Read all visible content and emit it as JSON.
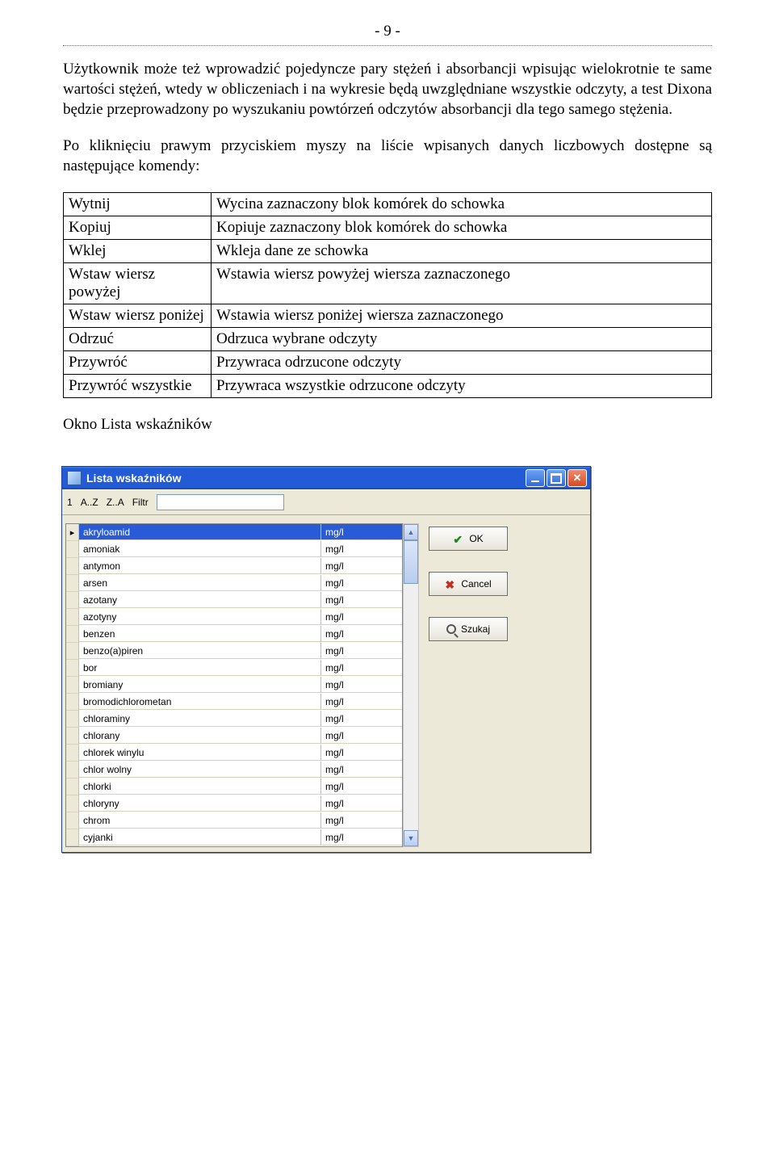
{
  "page_number": "- 9 -",
  "paragraph_1": "Użytkownik może też wprowadzić pojedyncze pary stężeń i absorbancji wpisując wielokrotnie te same wartości stężeń, wtedy w obliczeniach i na wykresie będą uwzględniane wszystkie odczyty, a test Dixona będzie przeprowadzony po wyszukaniu powtórzeń odczytów absorbancji dla tego samego stężenia.",
  "paragraph_2": "Po kliknięciu prawym przyciskiem myszy na liście wpisanych danych liczbowych dostępne są następujące komendy:",
  "commands": [
    {
      "name": "Wytnij",
      "desc": "Wycina zaznaczony blok komórek do schowka"
    },
    {
      "name": "Kopiuj",
      "desc": "Kopiuje zaznaczony blok komórek do schowka"
    },
    {
      "name": "Wklej",
      "desc": "Wkleja  dane ze schowka"
    },
    {
      "name": "Wstaw wiersz powyżej",
      "desc": "Wstawia wiersz powyżej wiersza zaznaczonego"
    },
    {
      "name": "Wstaw wiersz poniżej",
      "desc": "Wstawia wiersz poniżej wiersza zaznaczonego"
    },
    {
      "name": "Odrzuć",
      "desc": "Odrzuca wybrane odczyty"
    },
    {
      "name": "Przywróć",
      "desc": "Przywraca odrzucone odczyty"
    },
    {
      "name": "Przywróć wszystkie",
      "desc": "Przywraca wszystkie odrzucone odczyty"
    }
  ],
  "section_heading": "Okno Lista wskaźników",
  "window": {
    "title": "Lista wskaźników",
    "toolbar": {
      "btn1": "1",
      "sort_asc": "A..Z",
      "sort_desc": "Z..A",
      "filter_label": "Filtr",
      "filter_value": ""
    },
    "rows": [
      {
        "name": "akryloamid",
        "unit": "mg/l",
        "selected": true
      },
      {
        "name": "amoniak",
        "unit": "mg/l"
      },
      {
        "name": "antymon",
        "unit": "mg/l"
      },
      {
        "name": "arsen",
        "unit": "mg/l"
      },
      {
        "name": "azotany",
        "unit": "mg/l"
      },
      {
        "name": "azotyny",
        "unit": "mg/l"
      },
      {
        "name": "benzen",
        "unit": "mg/l"
      },
      {
        "name": "benzo(a)piren",
        "unit": "mg/l"
      },
      {
        "name": "bor",
        "unit": "mg/l"
      },
      {
        "name": "bromiany",
        "unit": "mg/l"
      },
      {
        "name": "bromodichlorometan",
        "unit": "mg/l"
      },
      {
        "name": "chloraminy",
        "unit": "mg/l"
      },
      {
        "name": "chlorany",
        "unit": "mg/l"
      },
      {
        "name": "chlorek winylu",
        "unit": "mg/l"
      },
      {
        "name": "chlor wolny",
        "unit": "mg/l"
      },
      {
        "name": "chlorki",
        "unit": "mg/l"
      },
      {
        "name": "chloryny",
        "unit": "mg/l"
      },
      {
        "name": "chrom",
        "unit": "mg/l"
      },
      {
        "name": "cyjanki",
        "unit": "mg/l"
      }
    ],
    "buttons": {
      "ok": "OK",
      "cancel": "Cancel",
      "search": "Szukaj"
    }
  }
}
